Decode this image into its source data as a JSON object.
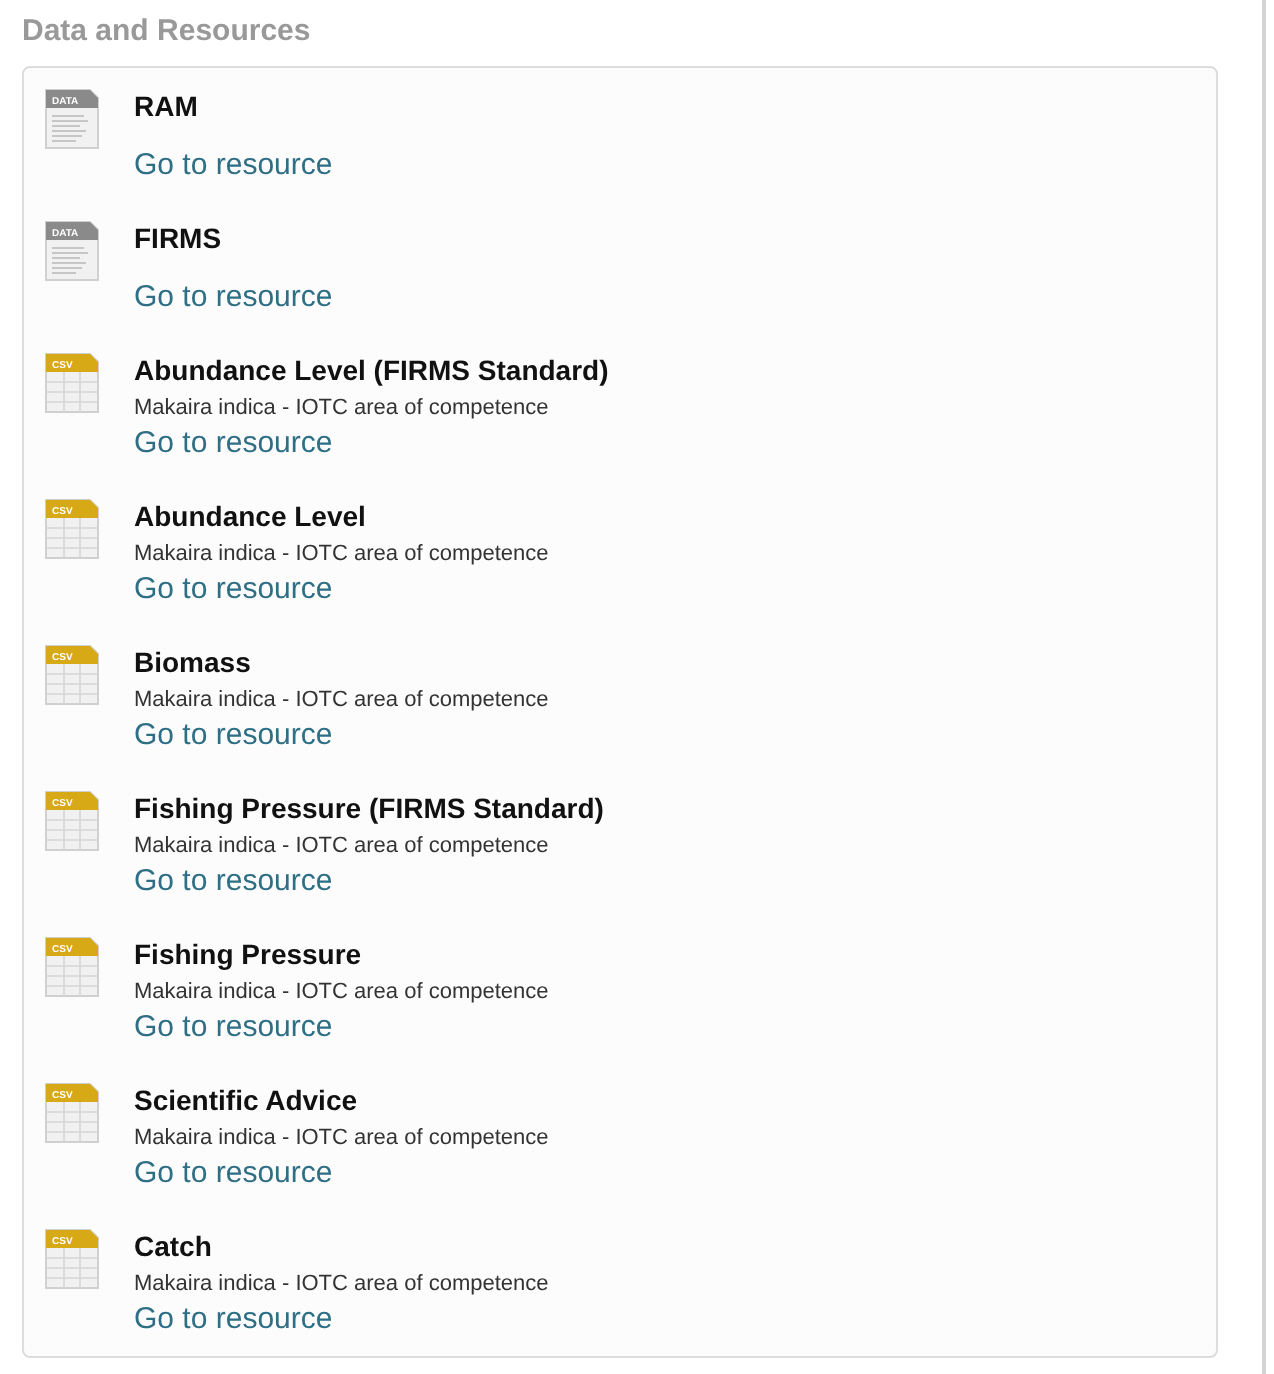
{
  "heading": "Data and Resources",
  "resources": [
    {
      "kind": "data",
      "format": "DATA",
      "title": "RAM",
      "link": "Go to resource"
    },
    {
      "kind": "data",
      "format": "DATA",
      "title": "FIRMS",
      "link": "Go to resource"
    },
    {
      "kind": "csv",
      "format": "CSV",
      "title": "Abundance Level (FIRMS Standard)",
      "description": "Makaira indica - IOTC area of competence",
      "link": "Go to resource"
    },
    {
      "kind": "csv",
      "format": "CSV",
      "title": "Abundance Level",
      "description": "Makaira indica - IOTC area of competence",
      "link": "Go to resource"
    },
    {
      "kind": "csv",
      "format": "CSV",
      "title": "Biomass",
      "description": "Makaira indica - IOTC area of competence",
      "link": "Go to resource"
    },
    {
      "kind": "csv",
      "format": "CSV",
      "title": "Fishing Pressure (FIRMS Standard)",
      "description": "Makaira indica - IOTC area of competence",
      "link": "Go to resource"
    },
    {
      "kind": "csv",
      "format": "CSV",
      "title": "Fishing Pressure",
      "description": "Makaira indica - IOTC area of competence",
      "link": "Go to resource"
    },
    {
      "kind": "csv",
      "format": "CSV",
      "title": "Scientific Advice",
      "description": "Makaira indica - IOTC area of competence",
      "link": "Go to resource"
    },
    {
      "kind": "csv",
      "format": "CSV",
      "title": "Catch",
      "description": "Makaira indica - IOTC area of competence",
      "link": "Go to resource"
    }
  ]
}
